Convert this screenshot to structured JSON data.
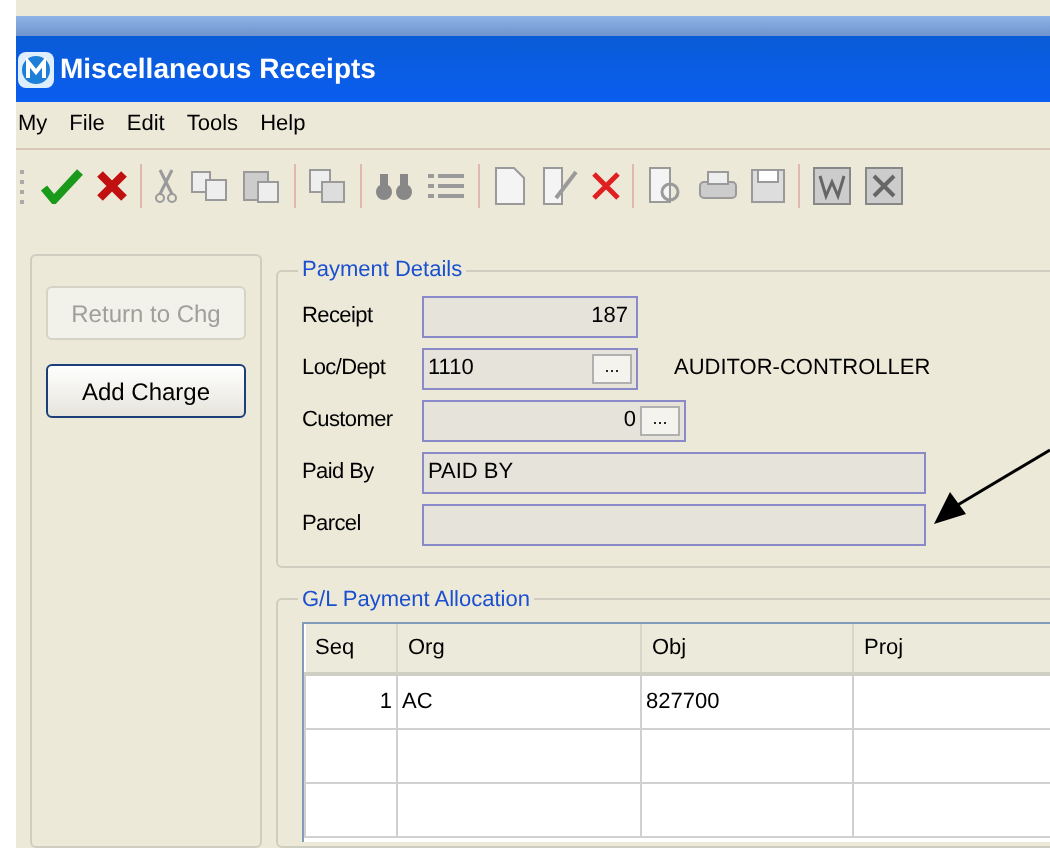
{
  "window": {
    "title": "Miscellaneous Receipts"
  },
  "menu": [
    "My",
    "File",
    "Edit",
    "Tools",
    "Help"
  ],
  "side_buttons": [
    {
      "label": "Return to Chg",
      "disabled": true
    },
    {
      "label": "Add Charge",
      "disabled": false
    }
  ],
  "payment_details": {
    "title": "Payment Details",
    "fields": [
      {
        "kind": "number",
        "label": "Receipt",
        "value": "187"
      },
      {
        "kind": "text",
        "label": "Loc/Dept",
        "value": "1110",
        "lookup": "...",
        "description": "AUDITOR-CONTROLLER"
      },
      {
        "kind": "number",
        "label": "Customer",
        "value": "0",
        "lookup": "..."
      },
      {
        "kind": "text",
        "label": "Paid By",
        "value": "PAID BY"
      },
      {
        "label": "Parcel"
      }
    ]
  },
  "allocation": {
    "title": "G/L Payment Allocation",
    "columns": [
      "Seq",
      "Org",
      "Obj",
      "Proj"
    ],
    "rows": [
      {
        "seq": "1",
        "org": "AC",
        "obj": "827700"
      }
    ]
  }
}
